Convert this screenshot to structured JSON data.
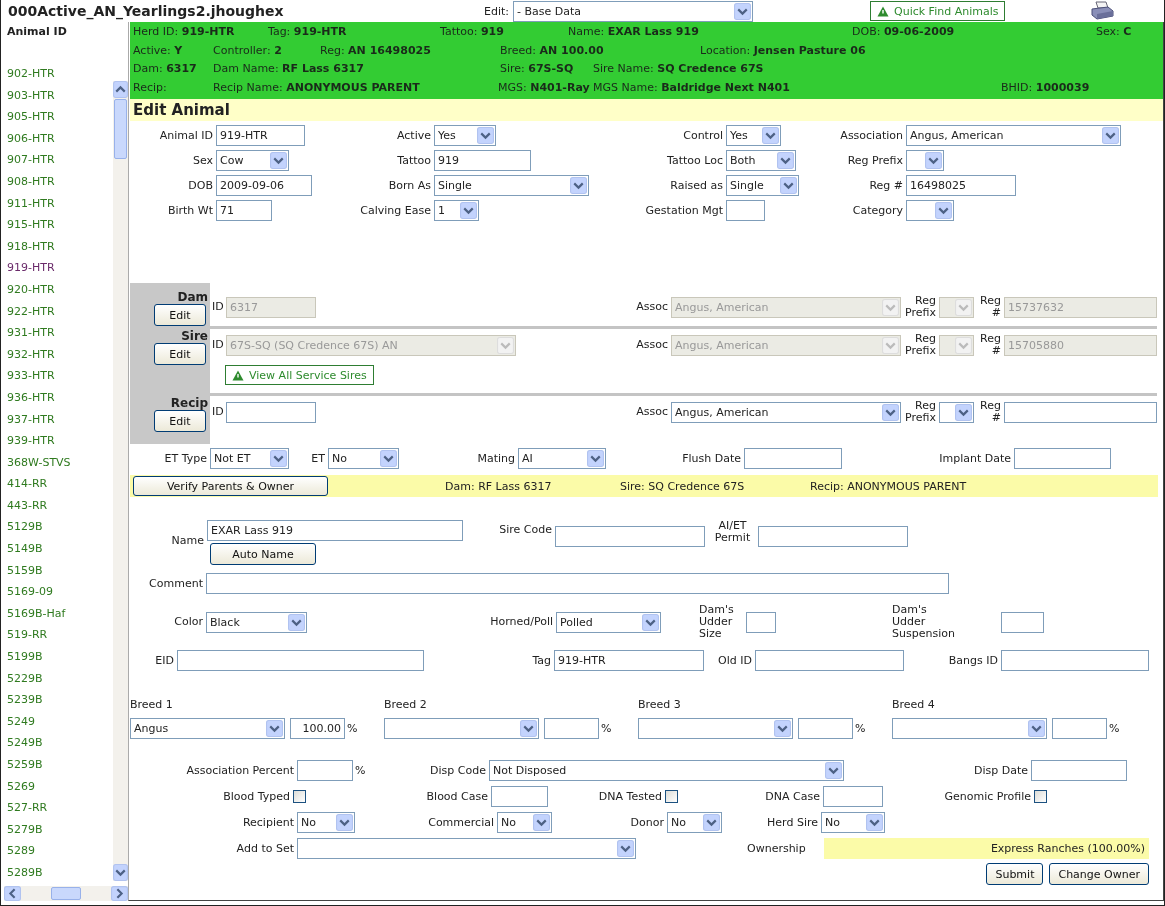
{
  "title": "000Active_AN_Yearlings2.jhoughex",
  "edit": {
    "label": "Edit:",
    "value": "- Base Data"
  },
  "quick_find": "Quick Find Animals",
  "sidebar": {
    "heading": "Animal ID",
    "items": [
      {
        "label": "902-HTR",
        "selected": false
      },
      {
        "label": "903-HTR",
        "selected": false
      },
      {
        "label": "905-HTR",
        "selected": false
      },
      {
        "label": "906-HTR",
        "selected": false
      },
      {
        "label": "907-HTR",
        "selected": false
      },
      {
        "label": "908-HTR",
        "selected": false
      },
      {
        "label": "911-HTR",
        "selected": false
      },
      {
        "label": "915-HTR",
        "selected": false
      },
      {
        "label": "918-HTR",
        "selected": false
      },
      {
        "label": "919-HTR",
        "selected": true
      },
      {
        "label": "920-HTR",
        "selected": false
      },
      {
        "label": "922-HTR",
        "selected": false
      },
      {
        "label": "931-HTR",
        "selected": false
      },
      {
        "label": "932-HTR",
        "selected": false
      },
      {
        "label": "933-HTR",
        "selected": false
      },
      {
        "label": "936-HTR",
        "selected": false
      },
      {
        "label": "937-HTR",
        "selected": false
      },
      {
        "label": "939-HTR",
        "selected": false
      },
      {
        "label": "368W-STVS",
        "selected": false
      },
      {
        "label": "414-RR",
        "selected": false
      },
      {
        "label": "443-RR",
        "selected": false
      },
      {
        "label": "5129B",
        "selected": false
      },
      {
        "label": "5149B",
        "selected": false
      },
      {
        "label": "5159B",
        "selected": false
      },
      {
        "label": "5169-09",
        "selected": false
      },
      {
        "label": "5169B-Haf",
        "selected": false
      },
      {
        "label": "519-RR",
        "selected": false
      },
      {
        "label": "5199B",
        "selected": false
      },
      {
        "label": "5229B",
        "selected": false
      },
      {
        "label": "5239B",
        "selected": false
      },
      {
        "label": "5249",
        "selected": false
      },
      {
        "label": "5249B",
        "selected": false
      },
      {
        "label": "5259B",
        "selected": false
      },
      {
        "label": "5269",
        "selected": false
      },
      {
        "label": "527-RR",
        "selected": false
      },
      {
        "label": "5279B",
        "selected": false
      },
      {
        "label": "5289",
        "selected": false
      },
      {
        "label": "5289B",
        "selected": false
      }
    ]
  },
  "summary": [
    [
      "Herd ID: **919-HTR**",
      "Tag: **919-HTR**",
      "Tattoo: **919**",
      "Name: **EXAR Lass 919**",
      "DOB: **09-06-2009**",
      "Sex: **C**"
    ],
    [
      "Active: **Y**",
      "Controller: **2**",
      "Reg: **AN 16498025**",
      "Breed: **AN 100.00**",
      "Location: **Jensen Pasture 06**"
    ],
    [
      "Dam: **6317**",
      "Dam Name: **RF Lass 6317**",
      "Sire: **67S-SQ**",
      "Sire Name: **SQ Credence 67S**"
    ],
    [
      "Recip:",
      "Recip Name: **ANONYMOUS PARENT**",
      "MGS: **N401-Ray**",
      "MGS Name: **Baldridge Next N401**",
      "BHID: **1000039**"
    ]
  ],
  "section_title": "Edit Animal",
  "main_rows": [
    [
      {
        "label": "Animal ID",
        "kind": "text",
        "value": "919-HTR"
      },
      {
        "label": "Active",
        "kind": "select",
        "value": "Yes"
      },
      {
        "label": "Control",
        "kind": "select",
        "value": "Yes"
      },
      {
        "label": "Association",
        "kind": "select",
        "value": "Angus, American"
      }
    ],
    [
      {
        "label": "Sex",
        "kind": "select",
        "value": "Cow"
      },
      {
        "label": "Tattoo",
        "kind": "text",
        "value": "919"
      },
      {
        "label": "Tattoo Loc",
        "kind": "select",
        "value": "Both"
      },
      {
        "label": "Reg Prefix",
        "kind": "select"
      }
    ],
    [
      {
        "label": "DOB",
        "kind": "text",
        "value": "2009-09-06"
      },
      {
        "label": "Born As",
        "kind": "select",
        "value": "Single"
      },
      {
        "label": "Raised as",
        "kind": "select",
        "value": "Single"
      },
      {
        "label": "Reg #",
        "kind": "text",
        "value": "16498025"
      }
    ],
    [
      {
        "label": "Birth Wt",
        "kind": "text",
        "value": "71"
      },
      {
        "label": "Calving Ease",
        "kind": "select",
        "value": "1"
      },
      {
        "label": "Gestation Mgt",
        "kind": "text"
      },
      {
        "label": "Category",
        "kind": "select"
      }
    ]
  ],
  "parents": [
    {
      "name": "Dam",
      "button": "Edit",
      "id_label": "ID",
      "id": {
        "kind": "text",
        "value": "6317"
      },
      "assoc_label": "Assoc",
      "assoc_value": "Angus, American",
      "prefix_label": "Reg Prefix",
      "reg_label": "Reg #",
      "reg_value": "15737632",
      "disabled": true
    },
    {
      "name": "Sire",
      "button": "Edit",
      "id_label": "ID",
      "id": {
        "kind": "select",
        "value": "67S-SQ (SQ Credence 67S) AN"
      },
      "assoc_label": "Assoc",
      "assoc_value": "Angus, American",
      "prefix_label": "Reg Prefix",
      "reg_label": "Reg #",
      "reg_value": "15705880",
      "disabled": true,
      "link": "View All Service Sires"
    },
    {
      "name": "Recip",
      "button": "Edit",
      "id_label": "ID",
      "id": {
        "kind": "text"
      },
      "assoc_label": "Assoc",
      "assoc_value": "Angus, American",
      "prefix_label": "Reg Prefix",
      "reg_label": "Reg #",
      "disabled": false
    }
  ],
  "et_rows": [
    [
      {
        "label": "ET Type",
        "kind": "select",
        "value": "Not ET"
      },
      {
        "label": "ET",
        "kind": "select",
        "value": "No"
      },
      {
        "label": "Mating",
        "kind": "select",
        "value": "AI"
      },
      {
        "label": "Flush Date",
        "kind": "text"
      },
      {
        "label": "Implant Date",
        "kind": "text"
      }
    ]
  ],
  "verify": {
    "button": "Verify Parents & Owner",
    "notes": [
      "Dam: RF Lass 6317",
      "Sire: SQ Credence 67S",
      "Recip: ANONYMOUS PARENT"
    ]
  },
  "name": {
    "label": "Name",
    "value": "EXAR Lass 919",
    "button": "Auto Name",
    "fields": [
      {
        "label": "Sire Code",
        "kind": "text"
      },
      {
        "label": "AI/ET Permit",
        "kind": "text"
      }
    ]
  },
  "detail_rows": [
    [
      {
        "label": "Comment",
        "kind": "text"
      }
    ],
    [
      {
        "label": "Color",
        "kind": "select",
        "value": "Black"
      },
      {
        "label": "Horned/Poll",
        "kind": "select",
        "value": "Polled"
      },
      {
        "label": "Dam's Udder Size",
        "kind": "text"
      },
      {
        "label": "Dam's Udder Suspension",
        "kind": "text"
      }
    ],
    [
      {
        "label": "EID",
        "kind": "text"
      },
      {
        "label": "Tag",
        "kind": "text",
        "value": "919-HTR"
      },
      {
        "label": "Old ID",
        "kind": "text"
      },
      {
        "label": "Bangs ID",
        "kind": "text"
      }
    ]
  ],
  "breeds": [
    {
      "label": "Breed 1",
      "value": "Angus",
      "percent": "100.00",
      "unit": "%"
    },
    {
      "label": "Breed 2",
      "unit": "%"
    },
    {
      "label": "Breed 3",
      "unit": "%"
    },
    {
      "label": "Breed 4",
      "unit": "%"
    }
  ],
  "bottom_rows": [
    [
      {
        "label": "Association Percent",
        "kind": "text",
        "unit": "%"
      },
      {
        "label": "Disp Code",
        "kind": "select",
        "value": "Not Disposed"
      },
      {
        "label": "Disp Date",
        "kind": "text"
      }
    ],
    [
      {
        "label": "Blood Typed",
        "kind": "checkbox",
        "checked": false
      },
      {
        "label": "Blood Case",
        "kind": "text"
      },
      {
        "label": "DNA Tested",
        "kind": "checkbox",
        "checked": false
      },
      {
        "label": "DNA Case",
        "kind": "text"
      },
      {
        "label": "Genomic Profile",
        "kind": "checkbox",
        "checked": false
      }
    ],
    [
      {
        "label": "Recipient",
        "kind": "select",
        "value": "No"
      },
      {
        "label": "Commercial",
        "kind": "select",
        "value": "No"
      },
      {
        "label": "Donor",
        "kind": "select",
        "value": "No"
      },
      {
        "label": "Herd Sire",
        "kind": "select",
        "value": "No"
      }
    ],
    [
      {
        "label": "Add to Set",
        "kind": "select"
      }
    ]
  ],
  "ownership": {
    "label": "Ownership",
    "value": "Express Ranches (100.00%)"
  },
  "buttons": [
    "Submit",
    "Change Owner"
  ]
}
